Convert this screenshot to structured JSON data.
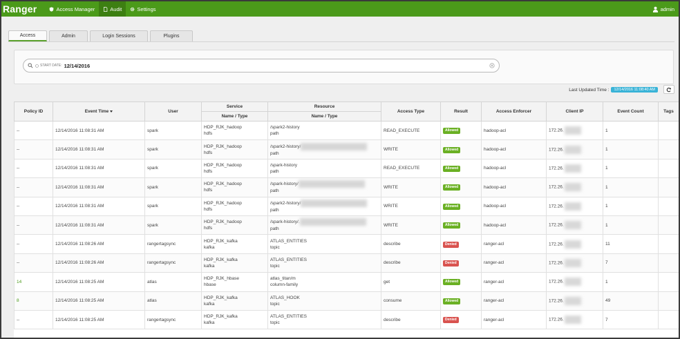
{
  "header": {
    "brand": "Ranger",
    "nav": [
      {
        "label": "Access Manager",
        "icon": "shield-icon",
        "active": false
      },
      {
        "label": "Audit",
        "icon": "file-icon",
        "active": true
      },
      {
        "label": "Settings",
        "icon": "gear-icon",
        "active": false
      }
    ],
    "user": "admin"
  },
  "tabs": [
    "Access",
    "Admin",
    "Login Sessions",
    "Plugins"
  ],
  "active_tab": "Access",
  "search": {
    "filter_label": "START DATE:",
    "filter_value": "12/14/2016"
  },
  "last_updated": {
    "label": "Last Updated Time :",
    "value": "12/14/2016 11:08:40 AM"
  },
  "table": {
    "group_headers": {
      "service": "Service",
      "resource": "Resource"
    },
    "columns": {
      "policy_id": "Policy ID",
      "event_time": "Event Time",
      "user": "User",
      "service": "Name / Type",
      "resource": "Name / Type",
      "access_type": "Access Type",
      "result": "Result",
      "access_enforcer": "Access Enforcer",
      "client_ip": "Client IP",
      "event_count": "Event Count",
      "tags": "Tags"
    },
    "rows": [
      {
        "policy_id": "--",
        "event_time": "12/14/2016 11:08:31 AM",
        "user": "spark",
        "service_name": "HDP_RJK_hadoop",
        "service_type": "hdfs",
        "resource_name": "/spark2-history",
        "resource_type": "path",
        "access_type": "READ_EXECUTE",
        "result": "Allowed",
        "enforcer": "hadoop-acl",
        "client_ip": "172.26.",
        "event_count": "1"
      },
      {
        "policy_id": "--",
        "event_time": "12/14/2016 11:08:31 AM",
        "user": "spark",
        "service_name": "HDP_RJK_hadoop",
        "service_type": "hdfs",
        "resource_name": "/spark2-history/",
        "resource_type": "path",
        "access_type": "WRITE",
        "result": "Allowed",
        "enforcer": "hadoop-acl",
        "client_ip": "172.26.",
        "event_count": "1"
      },
      {
        "policy_id": "--",
        "event_time": "12/14/2016 11:08:31 AM",
        "user": "spark",
        "service_name": "HDP_RJK_hadoop",
        "service_type": "hdfs",
        "resource_name": "/spark-history",
        "resource_type": "path",
        "access_type": "READ_EXECUTE",
        "result": "Allowed",
        "enforcer": "hadoop-acl",
        "client_ip": "172.26.",
        "event_count": "1"
      },
      {
        "policy_id": "--",
        "event_time": "12/14/2016 11:08:31 AM",
        "user": "spark",
        "service_name": "HDP_RJK_hadoop",
        "service_type": "hdfs",
        "resource_name": "/spark-history/",
        "resource_type": "path",
        "access_type": "WRITE",
        "result": "Allowed",
        "enforcer": "hadoop-acl",
        "client_ip": "172.26.",
        "event_count": "1"
      },
      {
        "policy_id": "--",
        "event_time": "12/14/2016 11:08:31 AM",
        "user": "spark",
        "service_name": "HDP_RJK_hadoop",
        "service_type": "hdfs",
        "resource_name": "/spark2-history/",
        "resource_type": "path",
        "access_type": "WRITE",
        "result": "Allowed",
        "enforcer": "hadoop-acl",
        "client_ip": "172.26.",
        "event_count": "1"
      },
      {
        "policy_id": "--",
        "event_time": "12/14/2016 11:08:31 AM",
        "user": "spark",
        "service_name": "HDP_RJK_hadoop",
        "service_type": "hdfs",
        "resource_name": "/spark-history/.",
        "resource_type": "path",
        "access_type": "WRITE",
        "result": "Allowed",
        "enforcer": "hadoop-acl",
        "client_ip": "172.26.",
        "event_count": "1"
      },
      {
        "policy_id": "--",
        "event_time": "12/14/2016 11:08:26 AM",
        "user": "rangertagsync",
        "service_name": "HDP_RJK_kafka",
        "service_type": "kafka",
        "resource_name": "ATLAS_ENTITIES",
        "resource_type": "topic",
        "access_type": "describe",
        "result": "Denied",
        "enforcer": "ranger-acl",
        "client_ip": "172.26.",
        "event_count": "11"
      },
      {
        "policy_id": "--",
        "event_time": "12/14/2016 11:08:26 AM",
        "user": "rangertagsync",
        "service_name": "HDP_RJK_kafka",
        "service_type": "kafka",
        "resource_name": "ATLAS_ENTITIES",
        "resource_type": "topic",
        "access_type": "describe",
        "result": "Denied",
        "enforcer": "ranger-acl",
        "client_ip": "172.26.",
        "event_count": "7"
      },
      {
        "policy_id": "14",
        "event_time": "12/14/2016 11:08:25 AM",
        "user": "atlas",
        "service_name": "HDP_RJK_hbase",
        "service_type": "hbase",
        "resource_name": "atlas_titan/m",
        "resource_type": "column-family",
        "access_type": "get",
        "result": "Allowed",
        "enforcer": "ranger-acl",
        "client_ip": "172.26.",
        "event_count": "1"
      },
      {
        "policy_id": "8",
        "event_time": "12/14/2016 11:08:25 AM",
        "user": "atlas",
        "service_name": "HDP_RJK_kafka",
        "service_type": "kafka",
        "resource_name": "ATLAS_HOOK",
        "resource_type": "topic",
        "access_type": "consume",
        "result": "Allowed",
        "enforcer": "ranger-acl",
        "client_ip": "172.26.",
        "event_count": "49"
      },
      {
        "policy_id": "--",
        "event_time": "12/14/2016 11:08:25 AM",
        "user": "rangertagsync",
        "service_name": "HDP_RJK_kafka",
        "service_type": "kafka",
        "resource_name": "ATLAS_ENTITIES",
        "resource_type": "topic",
        "access_type": "describe",
        "result": "Denied",
        "enforcer": "ranger-acl",
        "client_ip": "172.26.",
        "event_count": "7"
      }
    ]
  },
  "colors": {
    "brand_green": "#4b9a1a",
    "allowed": "#6ab023",
    "denied": "#d9534f",
    "updated_badge": "#39b3d7"
  }
}
